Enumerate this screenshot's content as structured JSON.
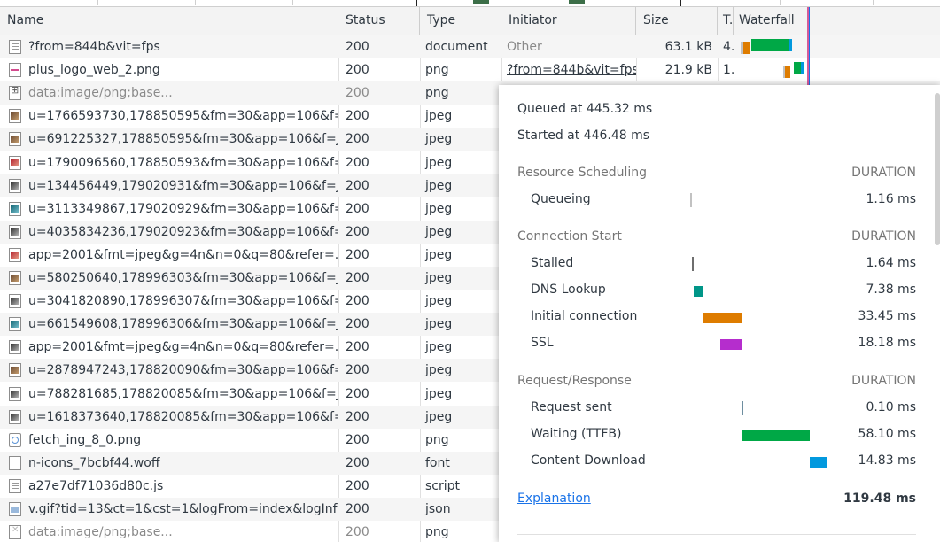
{
  "columns": {
    "name": "Name",
    "status": "Status",
    "type": "Type",
    "initiator": "Initiator",
    "size": "Size",
    "time": "T.",
    "waterfall": "Waterfall"
  },
  "colors": {
    "queue": "#c2c2c2",
    "dns": "#009688",
    "connect": "#de7c00",
    "ssl": "#b52dcd",
    "waiting": "#00a846",
    "download": "#0299de",
    "load_line": "#d35b9b",
    "dom_line": "#1a73e8"
  },
  "requests": [
    {
      "icon": "doc-icon",
      "name": "?from=844b&vit=fps",
      "status": "200",
      "type": "document",
      "initiator": "Other",
      "size": "63.1 kB",
      "time": "4."
    },
    {
      "icon": "image-icon",
      "name": "plus_logo_web_2.png",
      "status": "200",
      "type": "png",
      "initiator": "?from=844b&vit=fps",
      "size": "21.9 kB",
      "time": "1."
    },
    {
      "icon": "data-icon",
      "name": "data:image/png;base...",
      "status": "200",
      "type": "png",
      "initiator": "",
      "size": "",
      "time": ""
    },
    {
      "icon": "image-icon",
      "name": "u=1766593730,178850595&fm=30&app=106&f=...",
      "status": "200",
      "type": "jpeg",
      "initiator": "",
      "size": "",
      "time": ""
    },
    {
      "icon": "image-icon",
      "name": "u=691225327,178850595&fm=30&app=106&f=J...",
      "status": "200",
      "type": "jpeg",
      "initiator": "",
      "size": "",
      "time": ""
    },
    {
      "icon": "image-icon",
      "name": "u=1790096560,178850593&fm=30&app=106&f=...",
      "status": "200",
      "type": "jpeg",
      "initiator": "",
      "size": "",
      "time": ""
    },
    {
      "icon": "image-icon",
      "name": "u=134456449,179020931&fm=30&app=106&f=J...",
      "status": "200",
      "type": "jpeg",
      "initiator": "",
      "size": "",
      "time": ""
    },
    {
      "icon": "image-icon",
      "name": "u=3113349867,179020929&fm=30&app=106&f=...",
      "status": "200",
      "type": "jpeg",
      "initiator": "",
      "size": "",
      "time": ""
    },
    {
      "icon": "image-icon",
      "name": "u=4035834236,179020923&fm=30&app=106&f=...",
      "status": "200",
      "type": "jpeg",
      "initiator": "",
      "size": "",
      "time": ""
    },
    {
      "icon": "image-icon",
      "name": "app=2001&fmt=jpeg&g=4n&n=0&q=80&refer=...",
      "status": "200",
      "type": "jpeg",
      "initiator": "",
      "size": "",
      "time": ""
    },
    {
      "icon": "image-icon",
      "name": "u=580250640,178996303&fm=30&app=106&f=J...",
      "status": "200",
      "type": "jpeg",
      "initiator": "",
      "size": "",
      "time": ""
    },
    {
      "icon": "image-icon",
      "name": "u=3041820890,178996307&fm=30&app=106&f=...",
      "status": "200",
      "type": "jpeg",
      "initiator": "",
      "size": "",
      "time": ""
    },
    {
      "icon": "image-icon",
      "name": "u=661549608,178996306&fm=30&app=106&f=J...",
      "status": "200",
      "type": "jpeg",
      "initiator": "",
      "size": "",
      "time": ""
    },
    {
      "icon": "image-icon",
      "name": "app=2001&fmt=jpeg&g=4n&n=0&q=80&refer=...",
      "status": "200",
      "type": "jpeg",
      "initiator": "",
      "size": "",
      "time": ""
    },
    {
      "icon": "image-icon",
      "name": "u=2878947243,178820090&fm=30&app=106&f=...",
      "status": "200",
      "type": "jpeg",
      "initiator": "",
      "size": "",
      "time": ""
    },
    {
      "icon": "image-icon",
      "name": "u=788281685,178820085&fm=30&app=106&f=J...",
      "status": "200",
      "type": "jpeg",
      "initiator": "",
      "size": "",
      "time": ""
    },
    {
      "icon": "image-icon",
      "name": "u=1618373640,178820085&fm=30&app=106&f=...",
      "status": "200",
      "type": "jpeg",
      "initiator": "",
      "size": "",
      "time": ""
    },
    {
      "icon": "png-icon",
      "name": "fetch_ing_8_0.png",
      "status": "200",
      "type": "png",
      "initiator": "",
      "size": "",
      "time": ""
    },
    {
      "icon": "font-file-icon",
      "name": "n-icons_7bcbf44.woff",
      "status": "200",
      "type": "font",
      "initiator": "",
      "size": "",
      "time": ""
    },
    {
      "icon": "script-file-icon",
      "name": "a27e7df71036d80c.js",
      "status": "200",
      "type": "script",
      "initiator": "",
      "size": "",
      "time": ""
    },
    {
      "icon": "gif-icon",
      "name": "v.gif?tid=13&ct=1&cst=1&logFrom=index&logInf...",
      "status": "200",
      "type": "json",
      "initiator": "",
      "size": "",
      "time": ""
    },
    {
      "icon": "broken-image-icon",
      "name": "data:image/png;base...",
      "status": "200",
      "type": "png",
      "initiator": "",
      "size": "",
      "time": ""
    }
  ],
  "timing": {
    "queued_at": "Queued at 445.32 ms",
    "started_at": "Started at 446.48 ms",
    "duration_label": "DURATION",
    "sections": [
      {
        "title": "Resource Scheduling",
        "phases": [
          {
            "label": "Queueing",
            "duration": "1.16 ms",
            "start_ms": 445.32,
            "ms": 1.16,
            "color": "#c2c2c2"
          }
        ]
      },
      {
        "title": "Connection Start",
        "phases": [
          {
            "label": "Stalled",
            "duration": "1.64 ms",
            "start_ms": 446.48,
            "ms": 1.64,
            "color": "#6e6e6e"
          },
          {
            "label": "DNS Lookup",
            "duration": "7.38 ms",
            "start_ms": 448.12,
            "ms": 7.38,
            "color": "#009688"
          },
          {
            "label": "Initial connection",
            "duration": "33.45 ms",
            "start_ms": 455.5,
            "ms": 33.45,
            "color": "#de7c00"
          },
          {
            "label": "SSL",
            "duration": "18.18 ms",
            "start_ms": 470.77,
            "ms": 18.18,
            "color": "#b52dcd"
          }
        ]
      },
      {
        "title": "Request/Response",
        "phases": [
          {
            "label": "Request sent",
            "duration": "0.10 ms",
            "start_ms": 488.95,
            "ms": 0.1,
            "color": "#6e8ea0"
          },
          {
            "label": "Waiting (TTFB)",
            "duration": "58.10 ms",
            "start_ms": 489.05,
            "ms": 58.1,
            "color": "#00a846"
          },
          {
            "label": "Content Download",
            "duration": "14.83 ms",
            "start_ms": 547.15,
            "ms": 14.83,
            "color": "#0299de"
          }
        ]
      }
    ],
    "explanation": "Explanation",
    "total": "119.48 ms"
  }
}
